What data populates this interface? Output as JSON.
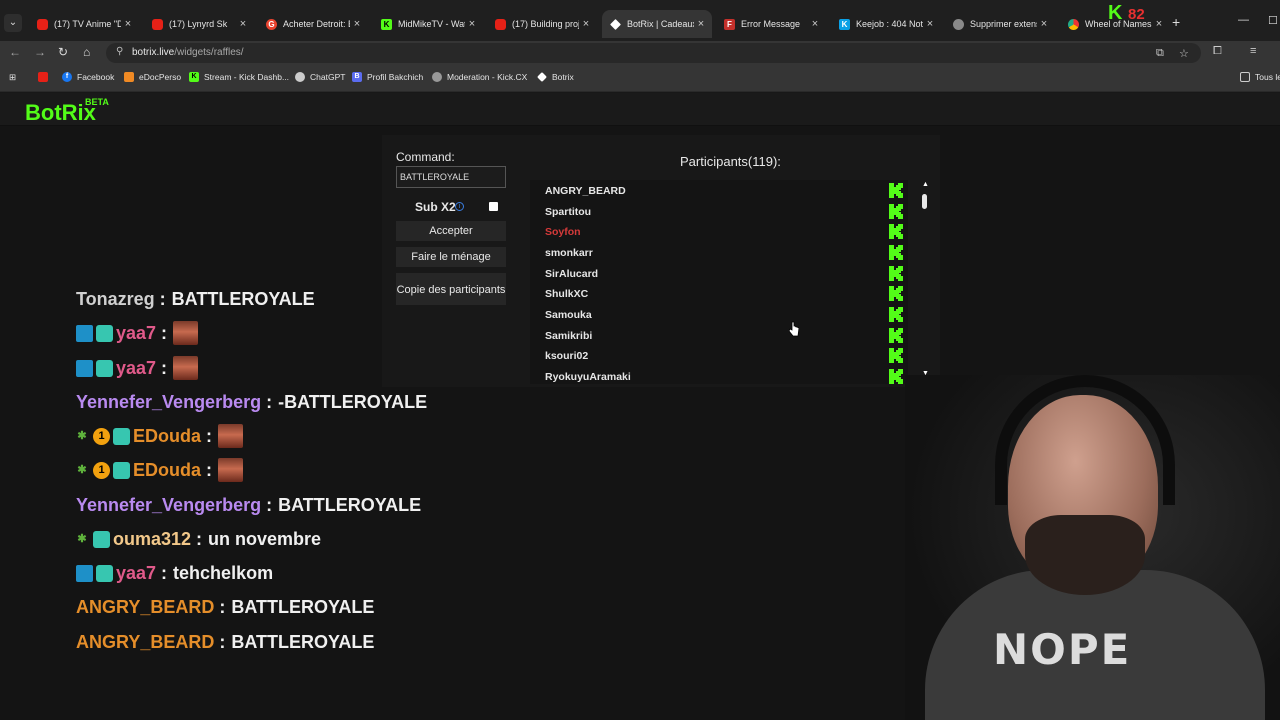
{
  "browser": {
    "tabs": [
      {
        "label": "(17) TV Anime \"Dr",
        "favicon": "youtube-icon"
      },
      {
        "label": "(17) Lynyrd Sk",
        "favicon": "youtube-icon"
      },
      {
        "label": "Acheter Detroit: B",
        "favicon": "g2a-icon"
      },
      {
        "label": "MidMikeTV - Wat",
        "favicon": "kick-icon"
      },
      {
        "label": "(17) Building proj",
        "favicon": "youtube-icon"
      },
      {
        "label": "BotRix | Cadeaux",
        "favicon": "botrix-icon",
        "active": true
      },
      {
        "label": "Error Message",
        "favicon": "f-icon"
      },
      {
        "label": "Keejob : 404 Not",
        "favicon": "keejob-icon"
      },
      {
        "label": "Supprimer extens",
        "favicon": "gear-icon"
      },
      {
        "label": "Wheel of Names",
        "favicon": "chrome-icon"
      }
    ],
    "overlay_counter": "82",
    "url_host": "botrix.live",
    "url_path": "/widgets/raffles/",
    "bookmarks": [
      "Facebook",
      "eDocPerso",
      "Stream - Kick Dashb...",
      "ChatGPT",
      "Profil Bakchich",
      "Moderation - Kick.CX",
      "Botrix"
    ],
    "bookmarks_right": "Tous le"
  },
  "app": {
    "logo": "BotRix",
    "logo_badge": "BETA",
    "command_label": "Command:",
    "command_value": "BATTLEROYALE",
    "sub_label": "Sub X2",
    "sub_checked": false,
    "accept_button": "Accepter",
    "clean_button": "Faire le ménage",
    "copy_button": "Copie des participants",
    "participants_title": "Participants(119):",
    "participants": [
      {
        "name": "ANGRY_BEARD",
        "color": "#e6e6e6"
      },
      {
        "name": "Spartitou",
        "color": "#e6e6e6"
      },
      {
        "name": "Soyfon",
        "color": "#d63a3a"
      },
      {
        "name": "smonkarr",
        "color": "#e6e6e6"
      },
      {
        "name": "SirAlucard",
        "color": "#e6e6e6"
      },
      {
        "name": "ShulkXC",
        "color": "#e6e6e6"
      },
      {
        "name": "Samouka",
        "color": "#e6e6e6"
      },
      {
        "name": "Samikribi",
        "color": "#e6e6e6"
      },
      {
        "name": "ksouri02",
        "color": "#e6e6e6"
      },
      {
        "name": "RyokuyuAramaki",
        "color": "#e6e6e6"
      }
    ]
  },
  "chat": [
    {
      "user": "Tonazreg",
      "color": "grey",
      "badges": [],
      "message": "BATTLEROYALE"
    },
    {
      "user": "yaa7",
      "color": "pink",
      "badges": [
        "mod",
        "sub"
      ],
      "message": "",
      "emote": true
    },
    {
      "user": "yaa7",
      "color": "pink",
      "badges": [
        "mod",
        "sub"
      ],
      "message": "",
      "emote": true
    },
    {
      "user": "Yennefer_Vengerberg",
      "color": "purple",
      "badges": [],
      "message": "-BATTLEROYALE"
    },
    {
      "user": "EDouda",
      "color": "orange",
      "badges": [
        "leaf",
        "gift",
        "sub"
      ],
      "message": "",
      "emote": true
    },
    {
      "user": "EDouda",
      "color": "orange",
      "badges": [
        "leaf",
        "gift",
        "sub"
      ],
      "message": "",
      "emote": true
    },
    {
      "user": "Yennefer_Vengerberg",
      "color": "purple",
      "badges": [],
      "message": "BATTLEROYALE"
    },
    {
      "user": "ouma312",
      "color": "tan",
      "badges": [
        "leaf",
        "sub"
      ],
      "message": "un novembre"
    },
    {
      "user": "yaa7",
      "color": "pink",
      "badges": [
        "mod",
        "sub"
      ],
      "message": "tehchelkom"
    },
    {
      "user": "ANGRY_BEARD",
      "color": "orange",
      "badges": [],
      "message": "BATTLEROYALE"
    },
    {
      "user": "ANGRY_BEARD",
      "color": "orange",
      "badges": [],
      "message": "BATTLEROYALE"
    }
  ],
  "webcam": {
    "shirt_text": "NOPE"
  }
}
